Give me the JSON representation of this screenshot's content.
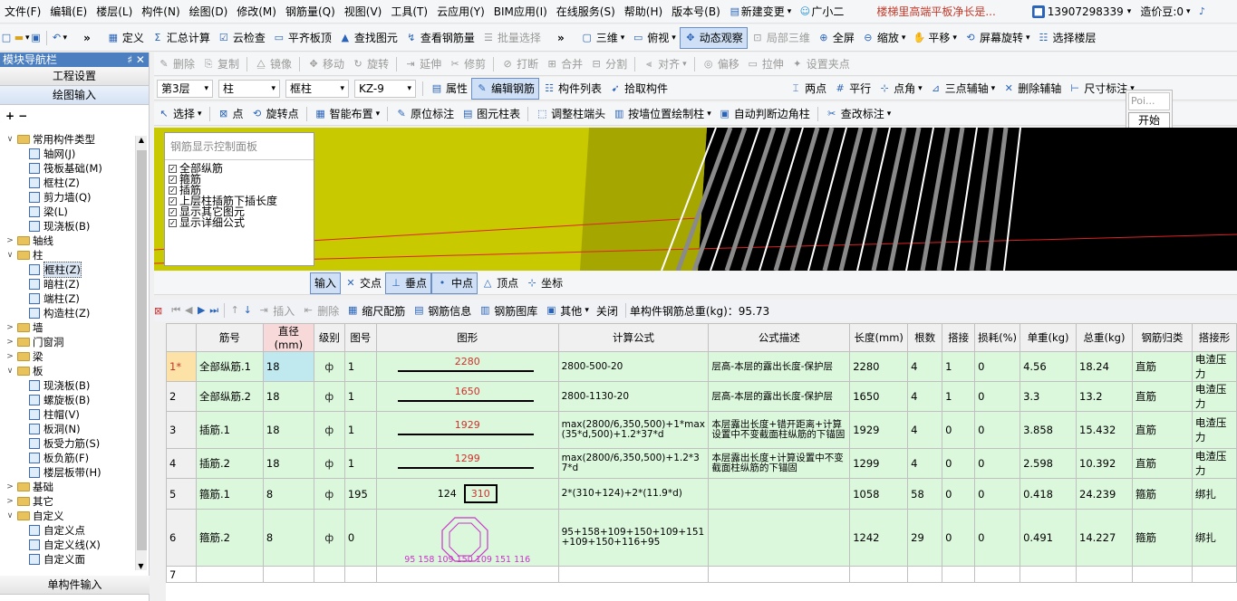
{
  "menu": [
    "文件(F)",
    "编辑(E)",
    "楼层(L)",
    "构件(N)",
    "绘图(D)",
    "修改(M)",
    "钢筋量(Q)",
    "视图(V)",
    "工具(T)",
    "云应用(Y)",
    "BIM应用(I)",
    "在线服务(S)",
    "帮助(H)",
    "版本号(B)"
  ],
  "menu_right": {
    "new_change": "新建变更",
    "assistant": "广小二",
    "notice": "楼梯里高端平板净长是...",
    "phone": "13907298339",
    "beans": "造价豆:0"
  },
  "toolbar1": [
    "定义",
    "汇总计算",
    "云检查",
    "平齐板顶",
    "查找图元",
    "查看钢筋量",
    "批量选择",
    "三维",
    "俯视",
    "动态观察",
    "局部三维",
    "全屏",
    "缩放",
    "平移",
    "屏幕旋转",
    "选择楼层"
  ],
  "nav": {
    "title": "模块导航栏",
    "pin": "♯ ✕",
    "btn_engineering": "工程设置",
    "btn_draw": "绘图输入",
    "tree": [
      {
        "t": "常用构件类型",
        "lvl": 0,
        "tog": "∨",
        "type": "folder"
      },
      {
        "t": "轴网(J)",
        "lvl": 1,
        "type": "item"
      },
      {
        "t": "筏板基础(M)",
        "lvl": 1,
        "type": "item"
      },
      {
        "t": "框柱(Z)",
        "lvl": 1,
        "type": "item"
      },
      {
        "t": "剪力墙(Q)",
        "lvl": 1,
        "type": "item"
      },
      {
        "t": "梁(L)",
        "lvl": 1,
        "type": "item"
      },
      {
        "t": "现浇板(B)",
        "lvl": 1,
        "type": "item"
      },
      {
        "t": "轴线",
        "lvl": 0,
        "tog": ">",
        "type": "folder"
      },
      {
        "t": "柱",
        "lvl": 0,
        "tog": "∨",
        "type": "folder"
      },
      {
        "t": "框柱(Z)",
        "lvl": 1,
        "type": "item",
        "sel": true
      },
      {
        "t": "暗柱(Z)",
        "lvl": 1,
        "type": "item"
      },
      {
        "t": "端柱(Z)",
        "lvl": 1,
        "type": "item"
      },
      {
        "t": "构造柱(Z)",
        "lvl": 1,
        "type": "item"
      },
      {
        "t": "墙",
        "lvl": 0,
        "tog": ">",
        "type": "folder"
      },
      {
        "t": "门窗洞",
        "lvl": 0,
        "tog": ">",
        "type": "folder"
      },
      {
        "t": "梁",
        "lvl": 0,
        "tog": ">",
        "type": "folder"
      },
      {
        "t": "板",
        "lvl": 0,
        "tog": "∨",
        "type": "folder"
      },
      {
        "t": "现浇板(B)",
        "lvl": 1,
        "type": "item"
      },
      {
        "t": "螺旋板(B)",
        "lvl": 1,
        "type": "item"
      },
      {
        "t": "柱帽(V)",
        "lvl": 1,
        "type": "item"
      },
      {
        "t": "板洞(N)",
        "lvl": 1,
        "type": "item"
      },
      {
        "t": "板受力筋(S)",
        "lvl": 1,
        "type": "item"
      },
      {
        "t": "板负筋(F)",
        "lvl": 1,
        "type": "item"
      },
      {
        "t": "楼层板带(H)",
        "lvl": 1,
        "type": "item"
      },
      {
        "t": "基础",
        "lvl": 0,
        "tog": ">",
        "type": "folder"
      },
      {
        "t": "其它",
        "lvl": 0,
        "tog": ">",
        "type": "folder"
      },
      {
        "t": "自定义",
        "lvl": 0,
        "tog": "∨",
        "type": "folder"
      },
      {
        "t": "自定义点",
        "lvl": 1,
        "type": "item"
      },
      {
        "t": "自定义线(X)",
        "lvl": 1,
        "type": "item"
      },
      {
        "t": "自定义面",
        "lvl": 1,
        "type": "item"
      }
    ],
    "btn_single": "单构件输入"
  },
  "toolbar2": [
    "删除",
    "复制",
    "镜像",
    "移动",
    "旋转",
    "延伸",
    "修剪",
    "打断",
    "合并",
    "分割",
    "对齐",
    "偏移",
    "拉伸",
    "设置夹点"
  ],
  "toolbar3": {
    "floor": "第3层",
    "type": "柱",
    "sub": "框柱",
    "name": "KZ-9",
    "btns": [
      "属性",
      "编辑钢筋",
      "构件列表",
      "拾取构件"
    ],
    "right": [
      "两点",
      "平行",
      "点角",
      "三点辅轴",
      "删除辅轴",
      "尺寸标注"
    ]
  },
  "toolbar4": [
    "选择",
    "点",
    "旋转点",
    "智能布置",
    "原位标注",
    "图元柱表",
    "调整柱端头",
    "按墙位置绘制柱",
    "自动判断边角柱",
    "查改标注"
  ],
  "popup": {
    "placeholder": "Poi...",
    "start": "开始"
  },
  "panel": {
    "title": "钢筋显示控制面板",
    "items": [
      "全部纵筋",
      "箍筋",
      "插筋",
      "上层柱插筋下插长度",
      "显示其它图元",
      "显示详细公式"
    ]
  },
  "snap": {
    "input": "输入",
    "items": [
      "交点",
      "垂点",
      "中点",
      "顶点",
      "坐标"
    ]
  },
  "rebar_toolbar": {
    "items": [
      "插入",
      "删除",
      "缩尺配筋",
      "钢筋信息",
      "钢筋图库",
      "其他",
      "关闭"
    ],
    "total": "单构件钢筋总重(kg)：95.73"
  },
  "table": {
    "headers": [
      "筋号",
      "直径(mm)",
      "级别",
      "图号",
      "图形",
      "计算公式",
      "公式描述",
      "长度(mm)",
      "根数",
      "搭接",
      "损耗(%)",
      "单重(kg)",
      "总重(kg)",
      "钢筋归类",
      "搭接形"
    ],
    "rows": [
      {
        "n": "1*",
        "name": "全部纵筋.1",
        "d": "18",
        "g": "ф",
        "fig": "1",
        "shape": "2280",
        "formula": "2800-500-20",
        "desc": "层高-本层的露出长度-保护层",
        "len": "2280",
        "cnt": "4",
        "lap": "1",
        "loss": "0",
        "uw": "4.56",
        "tw": "18.24",
        "cls": "直筋",
        "lt": "电渣压力"
      },
      {
        "n": "2",
        "name": "全部纵筋.2",
        "d": "18",
        "g": "ф",
        "fig": "1",
        "shape": "1650",
        "formula": "2800-1130-20",
        "desc": "层高-本层的露出长度-保护层",
        "len": "1650",
        "cnt": "4",
        "lap": "1",
        "loss": "0",
        "uw": "3.3",
        "tw": "13.2",
        "cls": "直筋",
        "lt": "电渣压力"
      },
      {
        "n": "3",
        "name": "插筋.1",
        "d": "18",
        "g": "ф",
        "fig": "1",
        "shape": "1929",
        "formula": "max(2800/6,350,500)+1*max(35*d,500)+1.2*37*d",
        "desc": "本层露出长度+错开距离+计算设置中不变截面柱纵筋的下锚固",
        "len": "1929",
        "cnt": "4",
        "lap": "0",
        "loss": "0",
        "uw": "3.858",
        "tw": "15.432",
        "cls": "直筋",
        "lt": "电渣压力"
      },
      {
        "n": "4",
        "name": "插筋.2",
        "d": "18",
        "g": "ф",
        "fig": "1",
        "shape": "1299",
        "formula": "max(2800/6,350,500)+1.2*37*d",
        "desc": "本层露出长度+计算设置中不变截面柱纵筋的下锚固",
        "len": "1299",
        "cnt": "4",
        "lap": "0",
        "loss": "0",
        "uw": "2.598",
        "tw": "10.392",
        "cls": "直筋",
        "lt": "电渣压力"
      },
      {
        "n": "5",
        "name": "箍筋.1",
        "d": "8",
        "g": "ф",
        "fig": "195",
        "shape": "310",
        "shape2": "124",
        "formula": "2*(310+124)+2*(11.9*d)",
        "desc": "",
        "len": "1058",
        "cnt": "58",
        "lap": "0",
        "loss": "0",
        "uw": "0.418",
        "tw": "24.239",
        "cls": "箍筋",
        "lt": "绑扎"
      },
      {
        "n": "6",
        "name": "箍筋.2",
        "d": "8",
        "g": "ф",
        "fig": "0",
        "shape": "95 158 109 150 109 151 116",
        "formula": "95+158+109+150+109+151+109+150+116+95",
        "desc": "",
        "len": "1242",
        "cnt": "29",
        "lap": "0",
        "loss": "0",
        "uw": "0.491",
        "tw": "14.227",
        "cls": "箍筋",
        "lt": "绑扎"
      },
      {
        "n": "7",
        "name": "",
        "d": "",
        "g": "",
        "fig": "",
        "shape": "",
        "formula": "",
        "desc": "",
        "len": "",
        "cnt": "",
        "lap": "",
        "loss": "",
        "uw": "",
        "tw": "",
        "cls": "",
        "lt": ""
      }
    ]
  },
  "colors": {
    "nav_title": "#4c7fc0",
    "grid_row": "#dbf7dc",
    "shape_red": "#d0312d",
    "octagon": "#cc33cc",
    "canvas_yellow": "#c9c900"
  }
}
